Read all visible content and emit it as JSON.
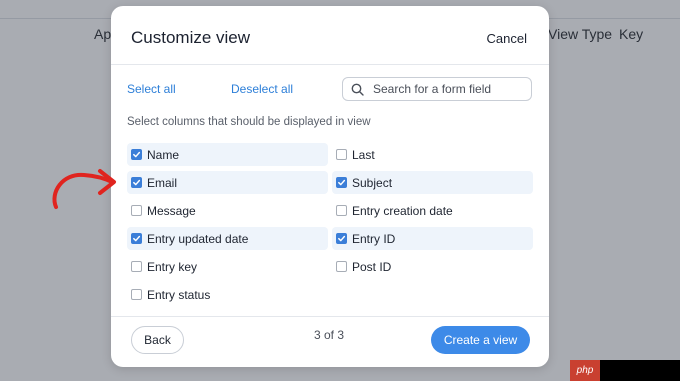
{
  "background": {
    "headers": [
      "Ap",
      "View Type",
      "Key"
    ]
  },
  "modal": {
    "title": "Customize view",
    "cancel_label": "Cancel",
    "select_all_label": "Select all",
    "deselect_all_label": "Deselect all",
    "search": {
      "placeholder": "Search for a form field",
      "value": ""
    },
    "instruction": "Select columns that should be displayed in view",
    "fields": [
      {
        "label": "Name",
        "checked": true
      },
      {
        "label": "Last",
        "checked": false
      },
      {
        "label": "Email",
        "checked": true
      },
      {
        "label": "Subject",
        "checked": true
      },
      {
        "label": "Message",
        "checked": false
      },
      {
        "label": "Entry creation date",
        "checked": false
      },
      {
        "label": "Entry updated date",
        "checked": true
      },
      {
        "label": "Entry ID",
        "checked": true
      },
      {
        "label": "Entry key",
        "checked": false
      },
      {
        "label": "Post ID",
        "checked": false
      },
      {
        "label": "Entry status",
        "checked": false
      }
    ],
    "footer": {
      "back_label": "Back",
      "page_indicator": "3 of 3",
      "create_label": "Create a view"
    }
  },
  "annotation": {
    "arrow_icon": "red-curved-arrow-icon",
    "color": "#e0241f"
  },
  "watermark": {
    "text": "php"
  },
  "colors": {
    "accent": "#3d8ae8",
    "link": "#2d7fd8",
    "checked_row": "#eef4fb"
  }
}
